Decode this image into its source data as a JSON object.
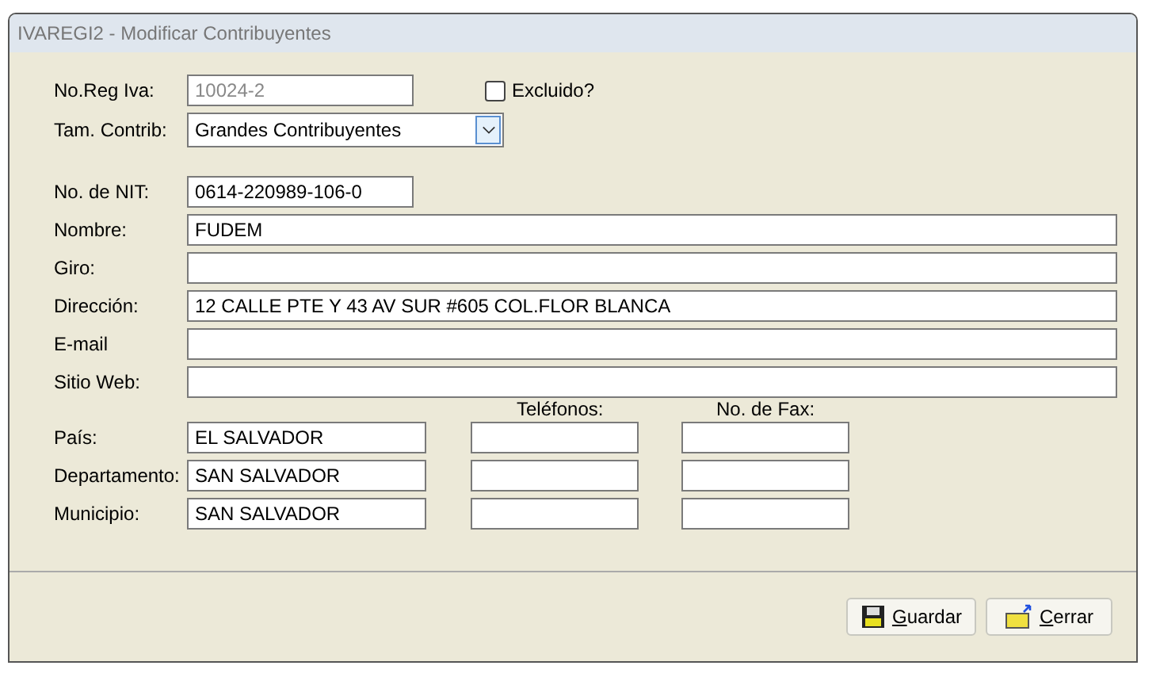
{
  "window": {
    "title": "IVAREGI2 - Modificar Contribuyentes"
  },
  "reg_iva": {
    "label": "No.Reg Iva:",
    "value": "10024-2",
    "disabled": true
  },
  "excluido": {
    "label": "Excluido?",
    "checked": false
  },
  "tam_contrib": {
    "label": "Tam. Contrib:",
    "value": "Grandes Contribuyentes"
  },
  "fields": [
    {
      "label": "No. de NIT:",
      "value": "0614-220989-106-0",
      "kind": "short"
    },
    {
      "label": "Nombre:",
      "value": "FUDEM",
      "kind": "wide"
    },
    {
      "label": "Giro:",
      "kind": "wide"
    },
    {
      "label": "Dirección:",
      "value": "12 CALLE PTE Y 43 AV SUR #605 COL.FLOR BLANCA",
      "kind": "wide"
    },
    {
      "label": "E-mail",
      "kind": "wide"
    },
    {
      "label": "Sitio Web:",
      "kind": "wide"
    }
  ],
  "location": {
    "phone_header": "Teléfonos:",
    "fax_header": "No. de Fax:",
    "rows": [
      {
        "label": "País:",
        "value": "EL SALVADOR"
      },
      {
        "label": "Departamento:",
        "value": "SAN SALVADOR"
      },
      {
        "label": "Municipio:",
        "value": "SAN SALVADOR"
      }
    ]
  },
  "buttons": [
    {
      "label": "Guardar",
      "kind": "save",
      "mnemonic_first": true
    },
    {
      "label": "Cerrar",
      "kind": "close",
      "mnemonic_first": true
    }
  ]
}
